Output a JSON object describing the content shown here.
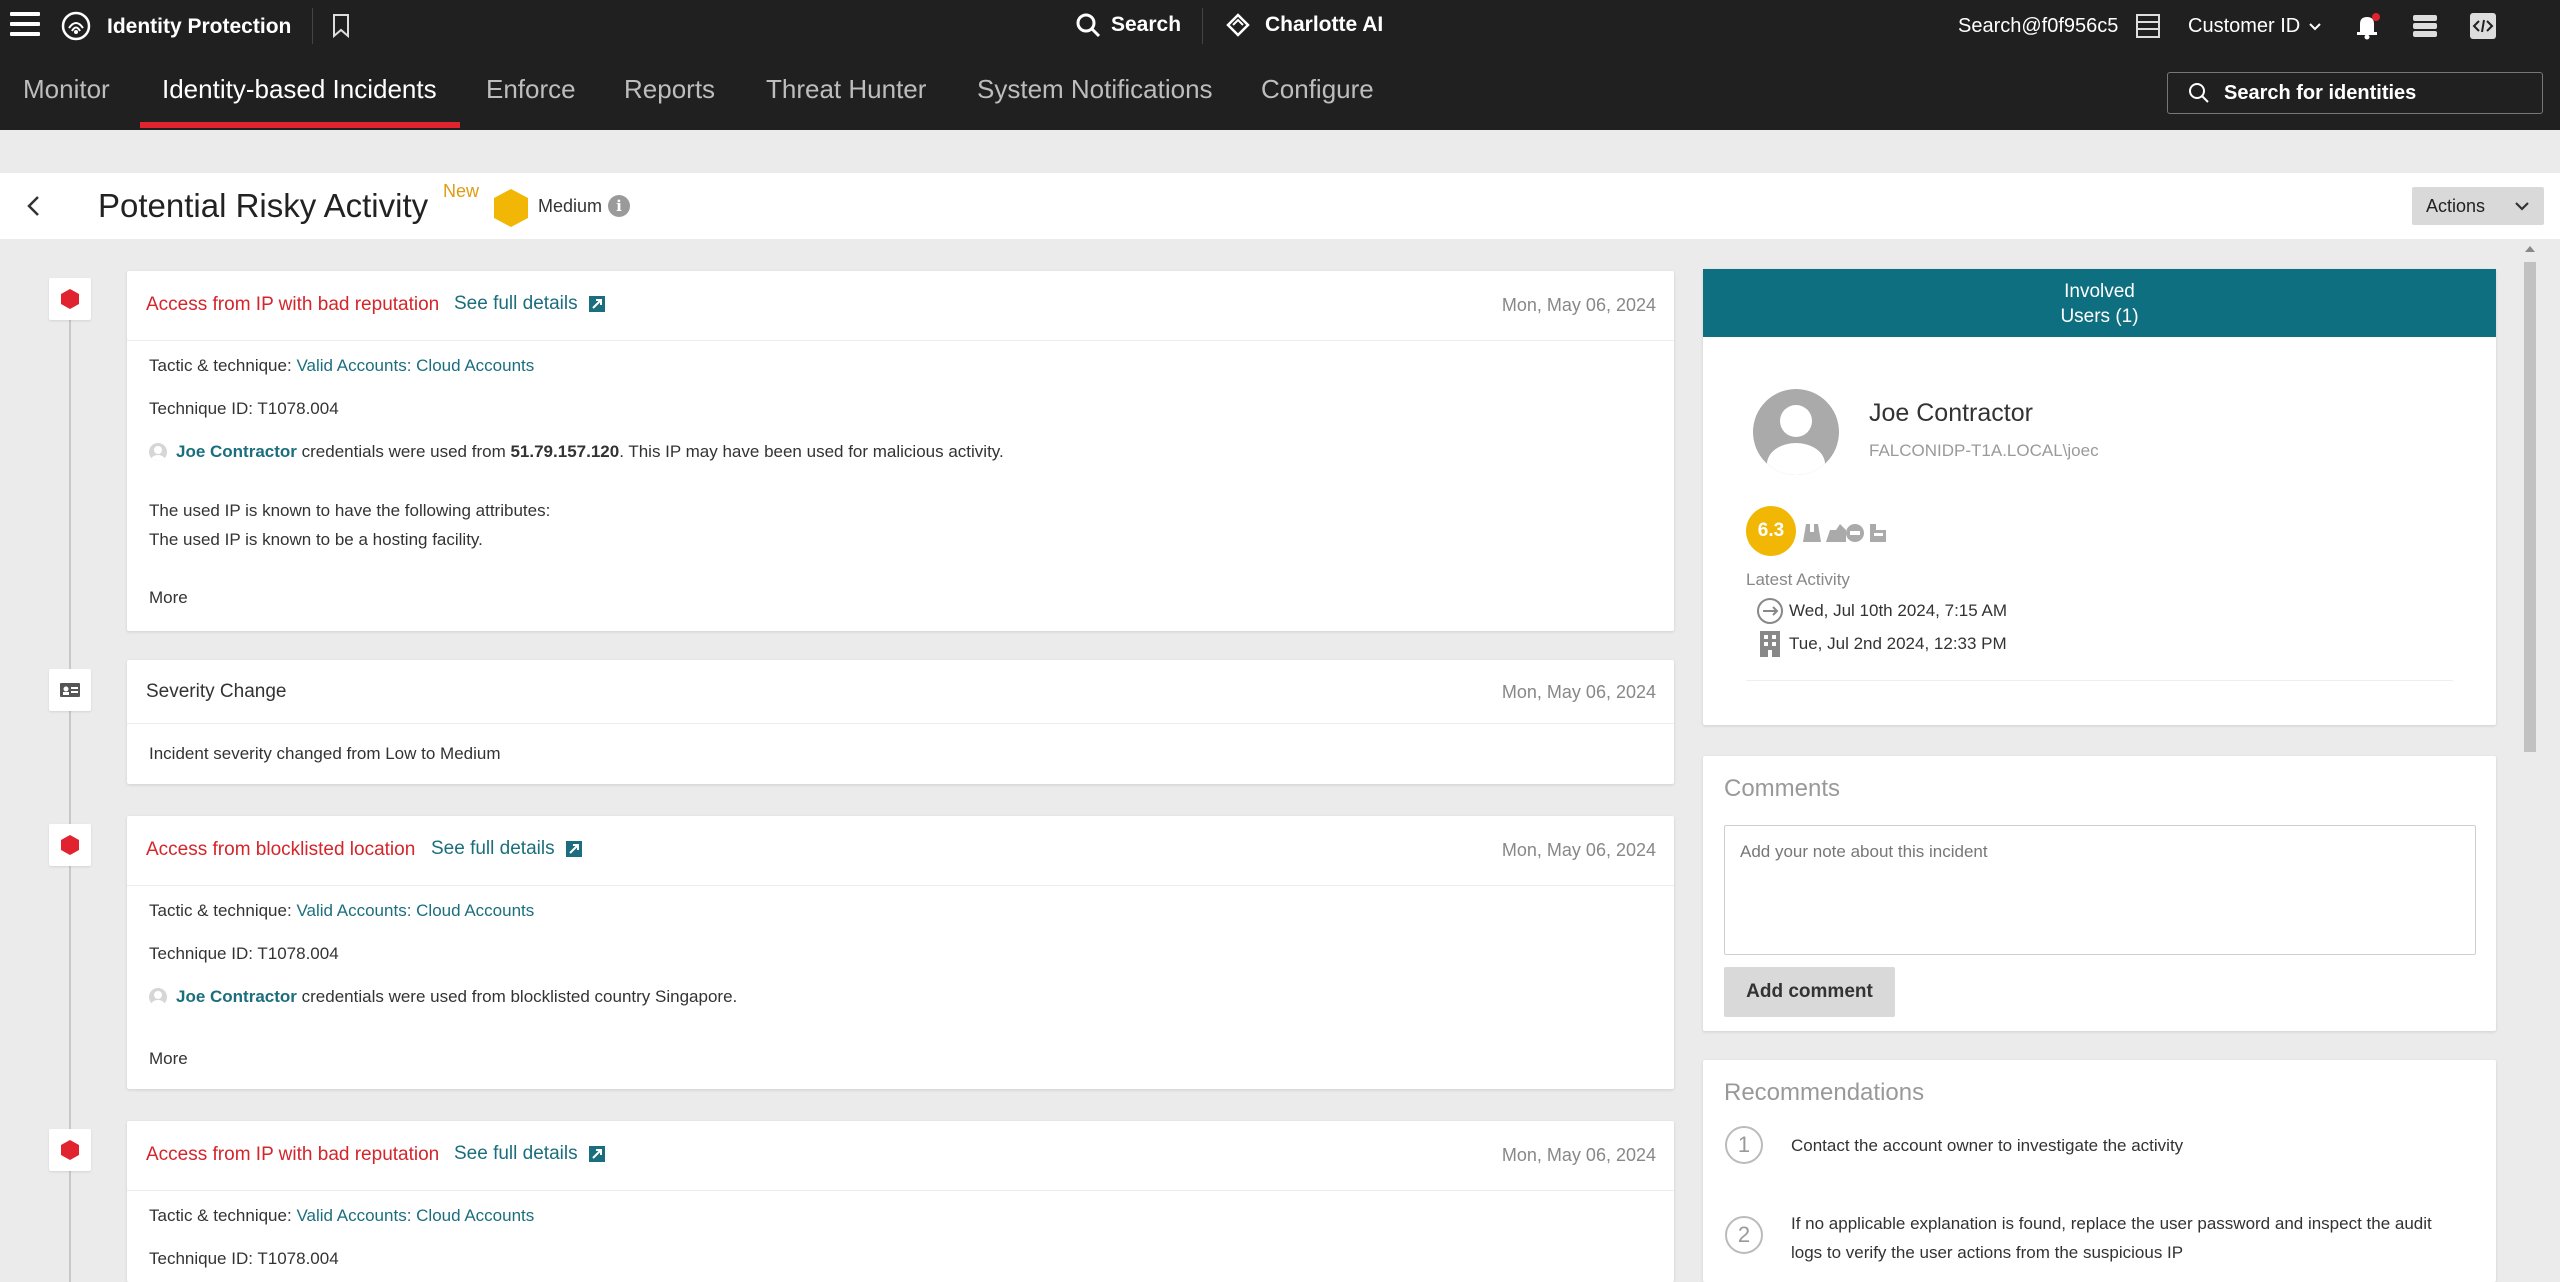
{
  "topbar": {
    "app_title": "Identity Protection",
    "search_label": "Search",
    "charlotte_label": "Charlotte AI",
    "cid_search": "Search@f0f956c5",
    "customer_label": "Customer ID"
  },
  "nav": {
    "tabs": [
      {
        "label": "Monitor"
      },
      {
        "label": "Identity-based Incidents"
      },
      {
        "label": "Enforce"
      },
      {
        "label": "Reports"
      },
      {
        "label": "Threat Hunter"
      },
      {
        "label": "System Notifications"
      },
      {
        "label": "Configure"
      }
    ],
    "search_placeholder": "Search for identities"
  },
  "header": {
    "title": "Potential Risky Activity",
    "new_badge": "New",
    "severity": "Medium",
    "actions_label": "Actions"
  },
  "events": [
    {
      "title": "Access from IP with bad reputation",
      "details_label": "See full details",
      "date": "Mon, May 06, 2024",
      "tactic_label": "Tactic & technique:",
      "tactic_value": "Valid Accounts: Cloud Accounts",
      "technique_id": "Technique ID: T1078.004",
      "user": "Joe Contractor",
      "desc_pre": " credentials were used from ",
      "ip": "51.79.157.120",
      "desc_post": ". This IP may have been used for malicious activity.",
      "attr_line1": "The used IP is known to have the following attributes:",
      "attr_line2": "The used IP is known to be a hosting facility.",
      "more": "More"
    },
    {
      "title": "Severity Change",
      "date": "Mon, May 06, 2024",
      "text": "Incident severity changed from Low to Medium"
    },
    {
      "title": "Access from blocklisted location",
      "details_label": "See full details",
      "date": "Mon, May 06, 2024",
      "tactic_label": "Tactic & technique:",
      "tactic_value": "Valid Accounts: Cloud Accounts",
      "technique_id": "Technique ID: T1078.004",
      "user": "Joe Contractor",
      "desc": " credentials were used from blocklisted country Singapore.",
      "more": "More"
    },
    {
      "title": "Access from IP with bad reputation",
      "details_label": "See full details",
      "date": "Mon, May 06, 2024",
      "tactic_label": "Tactic & technique:",
      "tactic_value": "Valid Accounts: Cloud Accounts",
      "technique_id": "Technique ID: T1078.004"
    }
  ],
  "involved": {
    "header_line1": "Involved",
    "header_line2": "Users (1)",
    "user_name": "Joe Contractor",
    "user_account": "FALCONIDP-T1A.LOCAL\\joec",
    "risk_score": "6.3",
    "latest_activity_label": "Latest Activity",
    "activity1": "Wed, Jul 10th 2024, 7:15 AM",
    "activity2": "Tue, Jul 2nd 2024, 12:33 PM"
  },
  "comments": {
    "title": "Comments",
    "placeholder": "Add your note about this incident",
    "button": "Add comment"
  },
  "recommendations": {
    "title": "Recommendations",
    "items": [
      {
        "num": "1",
        "text1": "Contact the account owner to investigate the activity",
        "text2": ""
      },
      {
        "num": "2",
        "text1": "If no applicable explanation is found, replace the user password and inspect the audit",
        "text2": "logs to verify the user actions from the suspicious IP"
      }
    ]
  },
  "colors": {
    "accent_red": "#e0232e",
    "link_teal": "#1b6e7d",
    "header_teal": "#0d6f80",
    "severity_medium": "#f2b705",
    "alert_red": "#d4252b"
  }
}
